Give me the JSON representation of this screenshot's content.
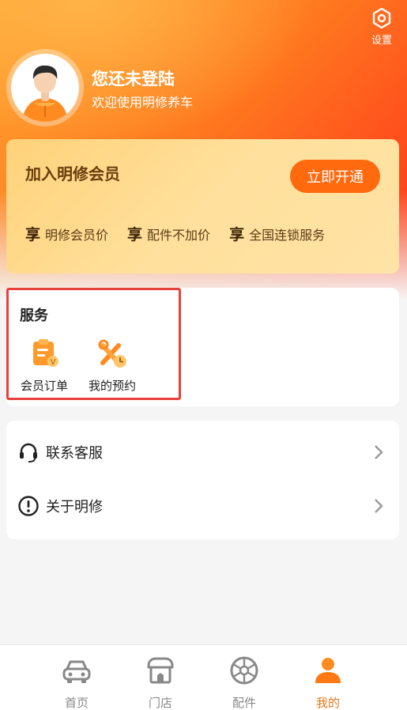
{
  "header": {
    "settings_label": "设置",
    "user_name": "您还未登陆",
    "user_subtitle": "欢迎使用明修养车"
  },
  "member": {
    "title": "加入明修会员",
    "button_label": "立即开通",
    "benefit_prefix": "享",
    "benefits": [
      "明修会员价",
      "配件不加价",
      "全国连锁服务"
    ]
  },
  "service": {
    "title": "服务",
    "items": [
      {
        "label": "会员订单",
        "icon": "member-order-icon"
      },
      {
        "label": "我的预约",
        "icon": "appointment-icon"
      }
    ]
  },
  "menu": {
    "items": [
      {
        "label": "联系客服",
        "icon": "headset-icon"
      },
      {
        "label": "关于明修",
        "icon": "info-icon"
      }
    ]
  },
  "tabbar": {
    "items": [
      {
        "label": "首页",
        "icon": "car-icon",
        "active": false
      },
      {
        "label": "门店",
        "icon": "store-icon",
        "active": false
      },
      {
        "label": "配件",
        "icon": "wheel-icon",
        "active": false
      },
      {
        "label": "我的",
        "icon": "person-icon",
        "active": true
      }
    ]
  },
  "colors": {
    "accent": "#ff6a0f",
    "active_tab": "#e87617",
    "highlight_border": "#e8403c"
  }
}
